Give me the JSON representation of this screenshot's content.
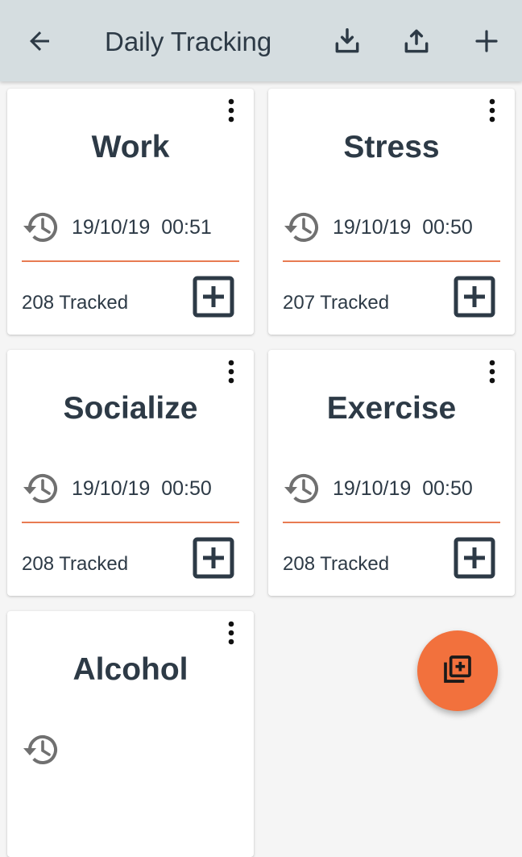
{
  "appbar": {
    "title": "Daily Tracking",
    "icons": [
      "arrow-back-icon",
      "download-icon",
      "upload-icon",
      "plus-icon"
    ]
  },
  "cards": [
    {
      "name": "Work",
      "last_time": "19/10/19  00:51",
      "tracked": "208 Tracked"
    },
    {
      "name": "Stress",
      "last_time": "19/10/19  00:50",
      "tracked": "207 Tracked"
    },
    {
      "name": "Socialize",
      "last_time": "19/10/19  00:50",
      "tracked": "208 Tracked"
    },
    {
      "name": "Exercise",
      "last_time": "19/10/19  00:50",
      "tracked": "208 Tracked"
    },
    {
      "name": "Alcohol",
      "last_time": "",
      "tracked": ""
    }
  ],
  "colors": {
    "appbar_bg": "#d5dde0",
    "text": "#2d3a46",
    "accent": "#f2713d",
    "divider": "#e87b52"
  }
}
